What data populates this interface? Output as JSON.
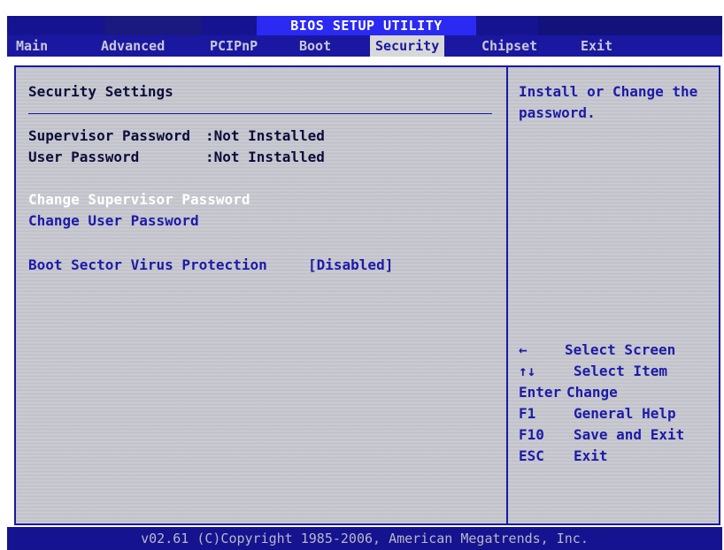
{
  "title": "BIOS SETUP UTILITY",
  "menu": [
    {
      "label": "Main"
    },
    {
      "label": "Advanced"
    },
    {
      "label": "PCIPnP"
    },
    {
      "label": "Boot"
    },
    {
      "label": "Security",
      "active": true
    },
    {
      "label": "Chipset"
    },
    {
      "label": "Exit"
    }
  ],
  "main": {
    "section_title": "Security Settings",
    "supervisor_password": {
      "label": "Supervisor Password",
      "value": ":Not Installed"
    },
    "user_password": {
      "label": "User Password",
      "value": ":Not Installed"
    },
    "change_supervisor": "Change Supervisor Password",
    "change_user": "Change User Password",
    "boot_sector": {
      "label": "Boot Sector Virus Protection",
      "value": "[Disabled]"
    }
  },
  "help": {
    "line1": "Install or Change the",
    "line2": "password."
  },
  "keys": [
    {
      "key": "←",
      "action": "Select Screen"
    },
    {
      "key": "↑↓",
      "action": "Select Item"
    },
    {
      "key": "Enter",
      "action": "Change"
    },
    {
      "key": "F1",
      "action": "General Help"
    },
    {
      "key": "F10",
      "action": "Save and Exit"
    },
    {
      "key": "ESC",
      "action": "Exit"
    }
  ],
  "footer": "v02.61 (C)Copyright 1985-2006, American Megatrends, Inc.",
  "colors": {
    "accent": "#1a18a0",
    "panel_bg": "#c6c7cf",
    "highlight": "#ffffff"
  }
}
